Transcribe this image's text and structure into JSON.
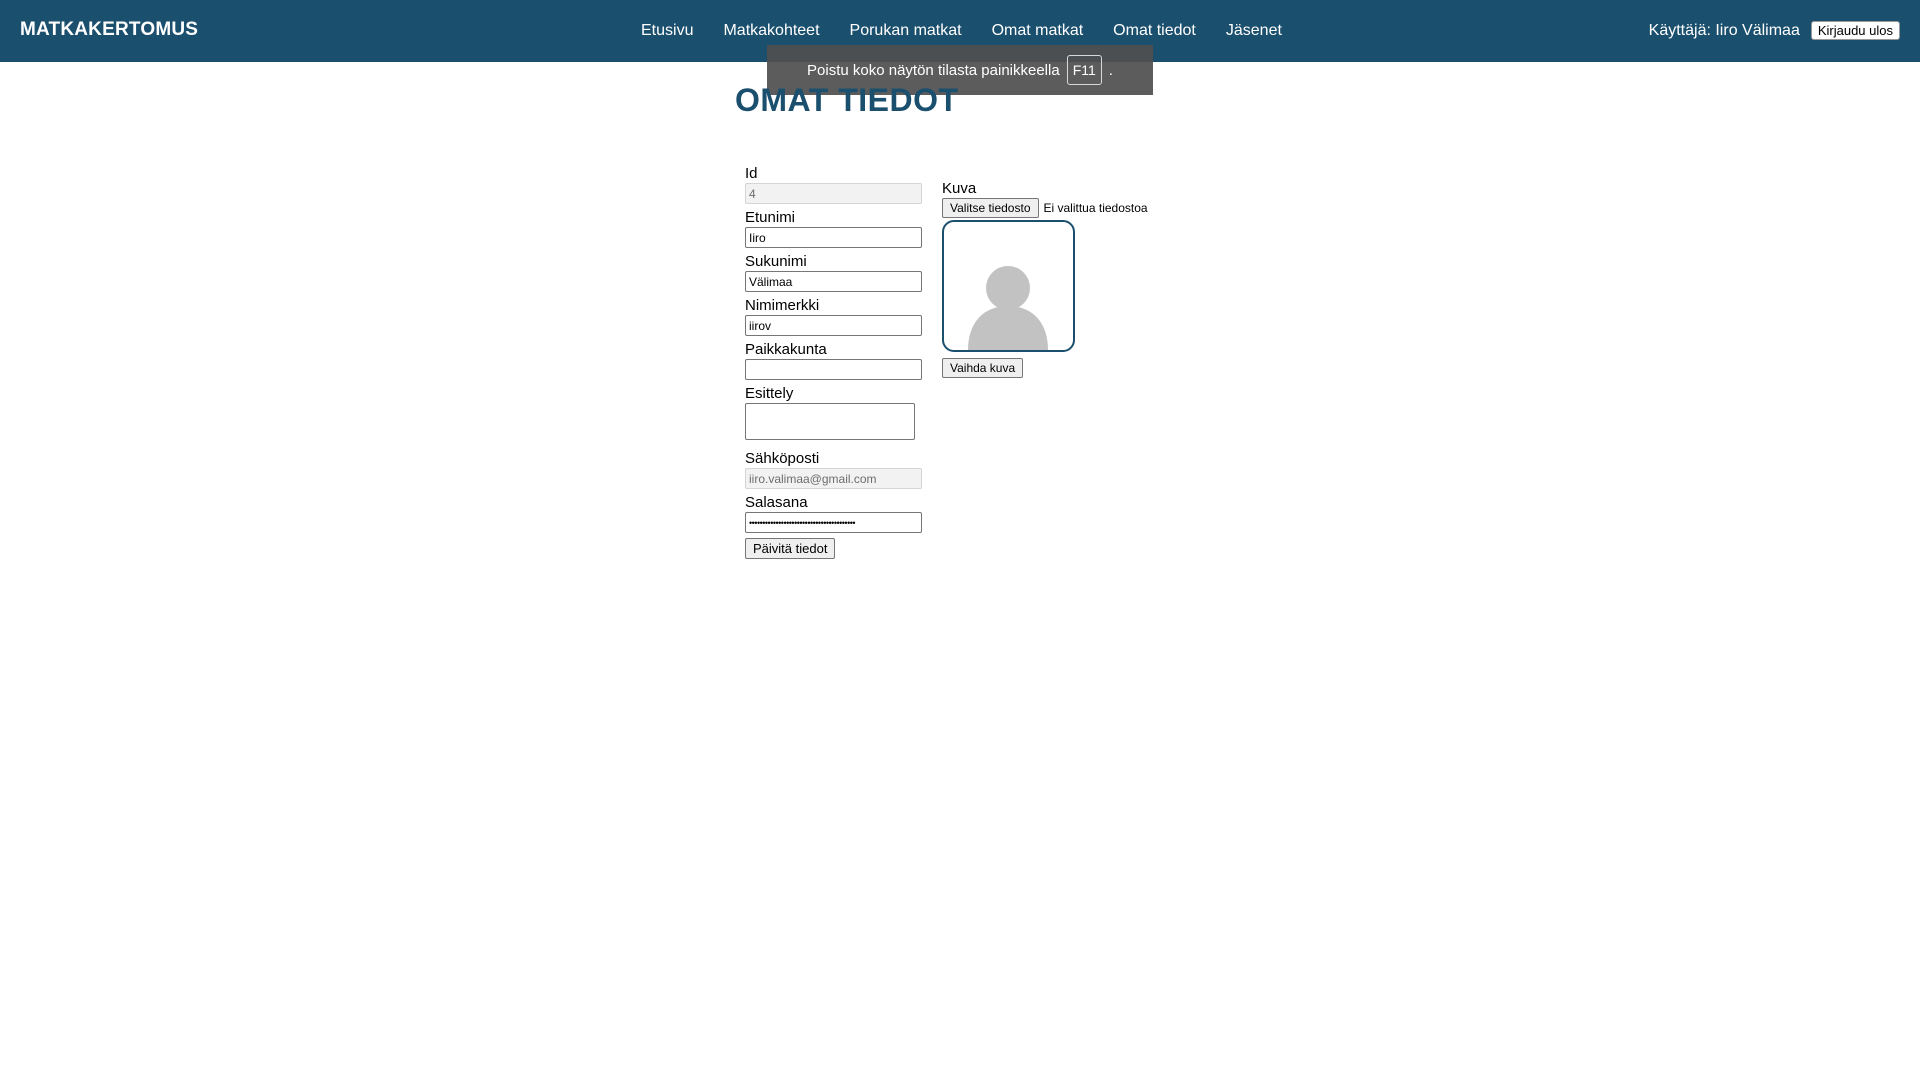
{
  "header": {
    "brand": "MATKAKERTOMUS",
    "nav": [
      "Etusivu",
      "Matkakohteet",
      "Porukan matkat",
      "Omat matkat",
      "Omat tiedot",
      "Jäsenet"
    ],
    "user_label": "Käyttäjä: Iiro Välimaa",
    "logout_label": "Kirjaudu ulos"
  },
  "fullscreen_notice": {
    "text": "Poistu koko näytön tilasta painikkeella",
    "key": "F11",
    "suffix": "."
  },
  "page": {
    "title": "OMAT TIEDOT"
  },
  "form": {
    "id": {
      "label": "Id",
      "value": "4"
    },
    "firstname": {
      "label": "Etunimi",
      "value": "Iiro"
    },
    "lastname": {
      "label": "Sukunimi",
      "value": "Välimaa"
    },
    "nickname": {
      "label": "Nimimerkki",
      "value": "iirov"
    },
    "city": {
      "label": "Paikkakunta",
      "value": ""
    },
    "intro": {
      "label": "Esittely",
      "value": ""
    },
    "email": {
      "label": "Sähköposti",
      "value": "iiro.valimaa@gmail.com"
    },
    "password": {
      "label": "Salasana",
      "value": "••••••••••••••••••••••••••••••••••••••••"
    },
    "submit_label": "Päivitä tiedot"
  },
  "picture": {
    "label": "Kuva",
    "choose_file_label": "Valitse tiedosto",
    "no_file_text": "Ei valittua tiedostoa",
    "change_label": "Vaihda kuva",
    "avatar_icon": "default-user-avatar"
  },
  "colors": {
    "header_bg": "#1b4f6e",
    "title": "#1b4f6e",
    "avatar_border": "#1b4f6e",
    "avatar_silhouette": "#c2c2c2"
  }
}
